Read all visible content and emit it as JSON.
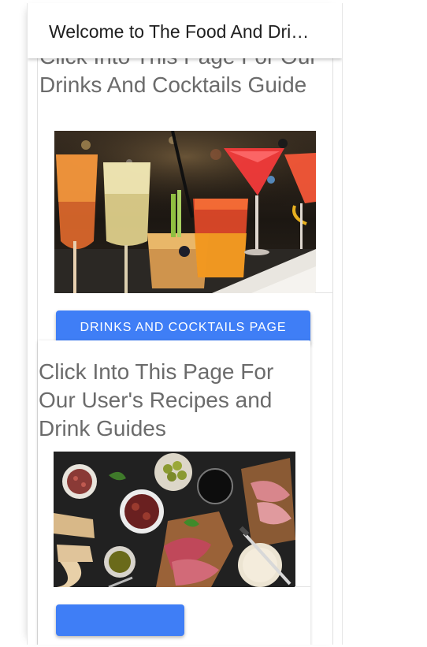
{
  "app_bar": {
    "title": "Welcome to The Food And Drink Guide"
  },
  "cards": [
    {
      "title": "Click Into This Page For Our Drinks And Cocktails Guide",
      "image_subject": "cocktails-on-bar",
      "button_label": "DRINKS AND COCKTAILS PAGE"
    },
    {
      "title": "Click Into This Page For Our User's Recipes and Drink Guides",
      "image_subject": "charcuterie-board",
      "button_label": ""
    }
  ],
  "colors": {
    "button": "#3f7ef6",
    "title_text": "#6b6b6b",
    "app_bar_text": "#202020"
  }
}
